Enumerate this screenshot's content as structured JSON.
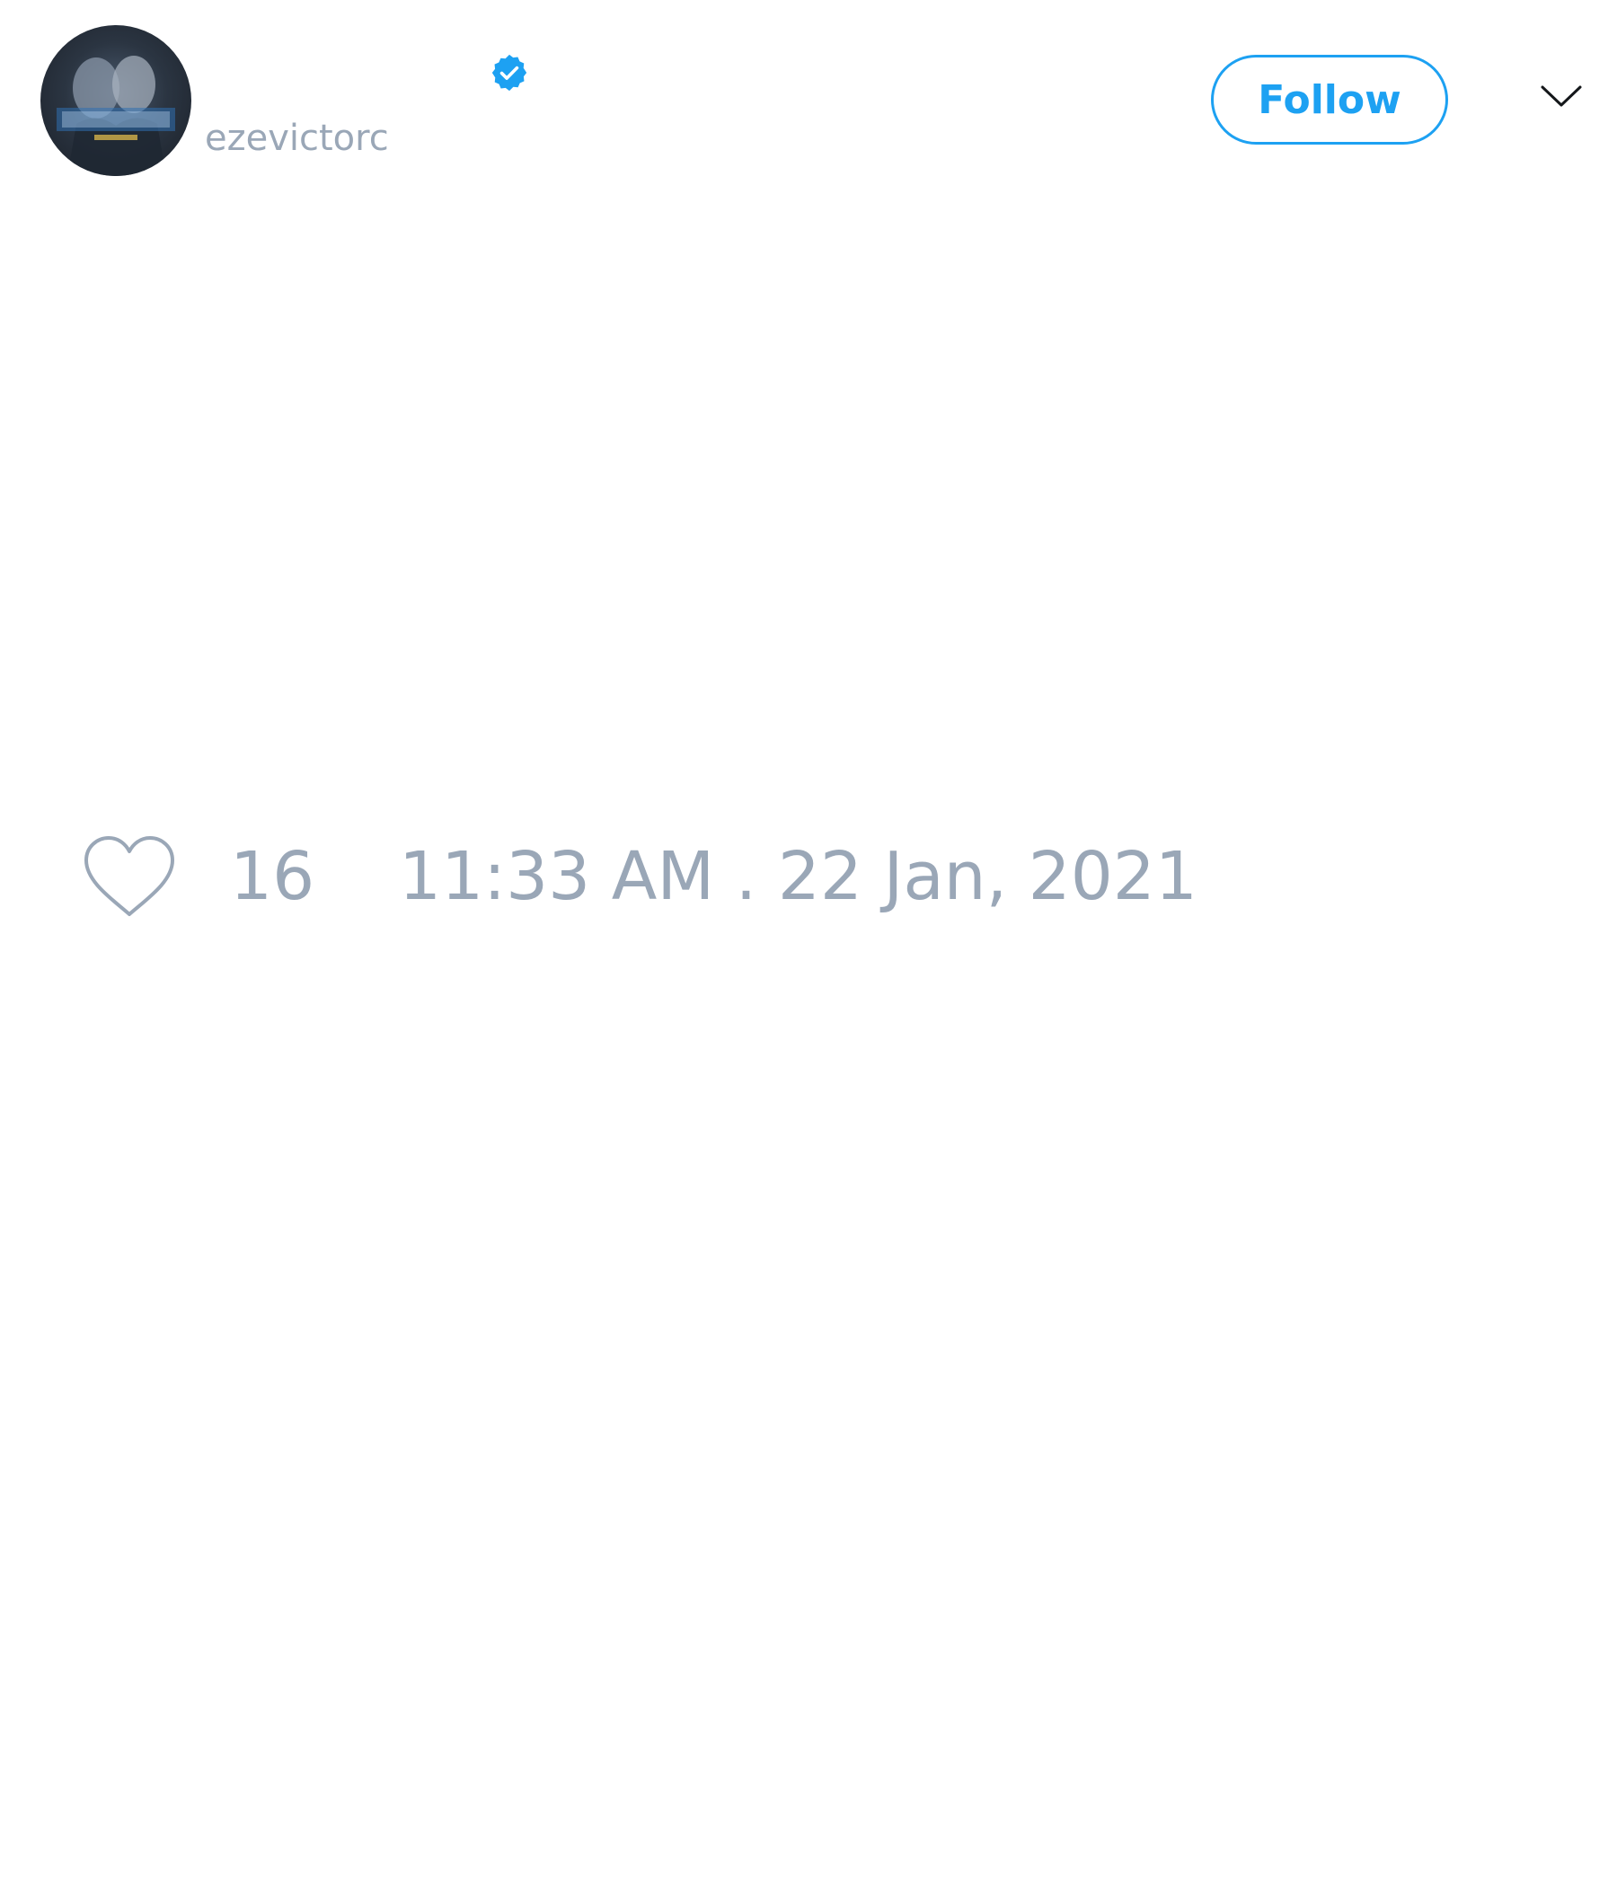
{
  "tweet": {
    "author": {
      "handle": "ezevictorc",
      "verified": true,
      "avatar_icon": "profile-avatar"
    },
    "follow_button": {
      "label": "Follow"
    },
    "menu_icon": "chevron-down-icon",
    "likes": {
      "icon": "heart-icon",
      "count": "16"
    },
    "timestamp": "11:33 AM . 22 Jan, 2021"
  },
  "colors": {
    "accent": "#1da1f2",
    "muted_text": "#9aa7b7",
    "background": "#ffffff"
  }
}
